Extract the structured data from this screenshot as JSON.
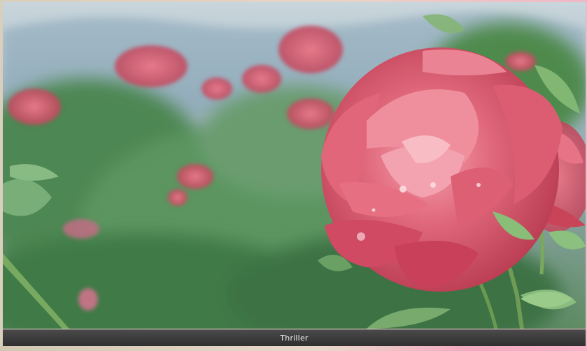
{
  "caption": {
    "title": "Thriller"
  },
  "image": {
    "subject_icon": "rose-photo"
  },
  "colors": {
    "caption_bar": "#3a3a3a",
    "caption_text": "#f1f1f1",
    "rose": "#d9546a",
    "foliage": "#4f8a55",
    "sky": "#aebfc9"
  }
}
